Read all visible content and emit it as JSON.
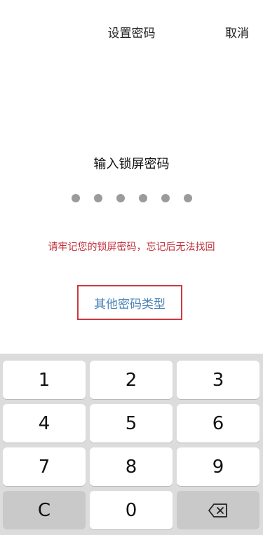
{
  "header": {
    "title": "设置密码",
    "cancel_label": "取消"
  },
  "prompt": "输入锁屏密码",
  "pin_dots_count": 6,
  "warning": "请牢记您的锁屏密码，忘记后无法找回",
  "other_password_type": "其他密码类型",
  "keypad": {
    "keys": [
      {
        "label": "1"
      },
      {
        "label": "2"
      },
      {
        "label": "3"
      },
      {
        "label": "4"
      },
      {
        "label": "5"
      },
      {
        "label": "6"
      },
      {
        "label": "7"
      },
      {
        "label": "8"
      },
      {
        "label": "9"
      },
      {
        "label": "C"
      },
      {
        "label": "0"
      },
      {
        "icon": "backspace-icon"
      }
    ]
  },
  "colors": {
    "warning_text": "#c0303a",
    "link_text": "#4d84b8",
    "highlight_border": "#c93a3f",
    "keypad_background": "#dcdcdc"
  }
}
